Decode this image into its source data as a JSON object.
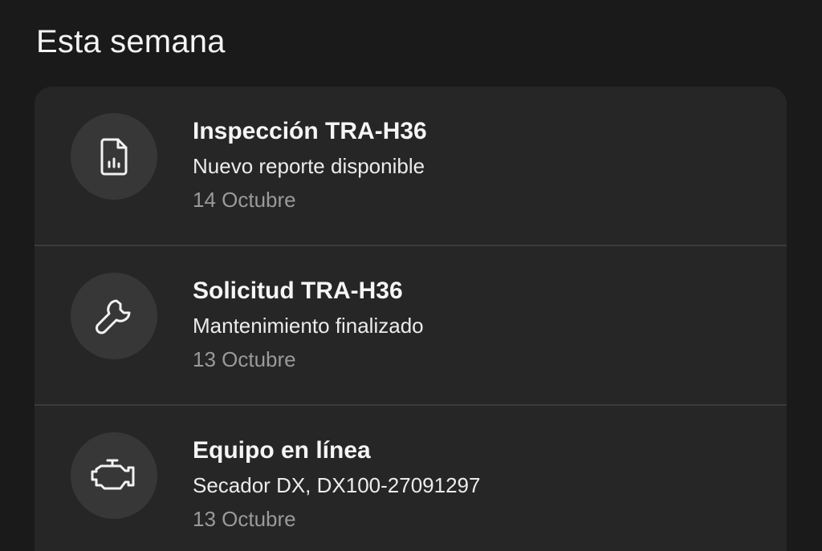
{
  "section": {
    "title": "Esta semana"
  },
  "notifications": [
    {
      "title": "Inspección TRA-H36",
      "subtitle": "Nuevo reporte disponible",
      "date": "14 Octubre",
      "icon": "report-icon"
    },
    {
      "title": "Solicitud TRA-H36",
      "subtitle": "Mantenimiento finalizado",
      "date": "13 Octubre",
      "icon": "wrench-icon"
    },
    {
      "title": "Equipo en línea",
      "subtitle": "Secador DX, DX100-27091297",
      "date": "13 Octubre",
      "icon": "engine-icon"
    }
  ],
  "colors": {
    "background": "#1a1a1a",
    "card": "#262626",
    "icon_circle": "#373737",
    "divider": "#3b3b3b",
    "date_text": "#9a9a9a"
  }
}
